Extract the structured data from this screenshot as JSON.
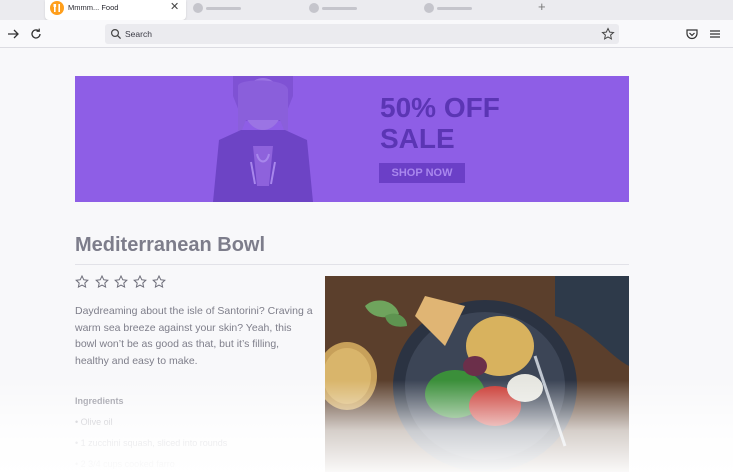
{
  "browser": {
    "active_tab": {
      "title": "Mmmm... Food",
      "favicon": "food-favicon-icon",
      "close_glyph": "✕"
    },
    "new_tab_glyph": "+",
    "urlbar": {
      "placeholder": "Search"
    },
    "icons": [
      "forward-icon",
      "reload-icon",
      "search-icon",
      "bookmark-star-icon",
      "pocket-icon",
      "menu-icon"
    ]
  },
  "banner": {
    "headline_line1": "50% OFF",
    "headline_line2": "SALE",
    "cta_label": "SHOP NOW",
    "colors": {
      "background": "#8e5ee6",
      "text": "#5b35b4"
    }
  },
  "recipe": {
    "title": "Mediterranean Bowl",
    "rating": {
      "filled": 0,
      "max": 5
    },
    "description": "Daydreaming about the isle of Santorini? Craving a warm sea breeze against your skin? Yeah, this bowl won’t be as good as that, but it’s filling, healthy and easy to make.",
    "ingredients_heading": "Ingredients",
    "ingredients": [
      "• Olive oil",
      "• 1 zucchini squash, sliced into rounds",
      "• 2 3/4 cups cooked farro"
    ]
  }
}
